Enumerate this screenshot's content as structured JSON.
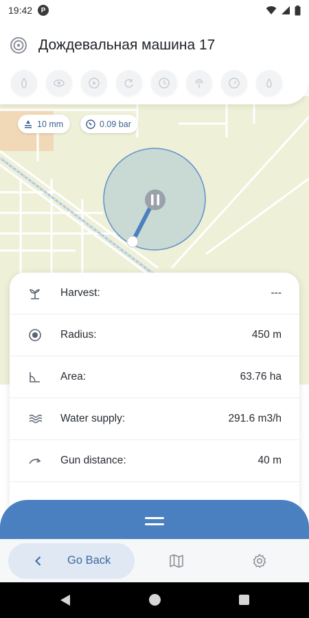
{
  "status_bar": {
    "time": "19:42",
    "icons": [
      "app-notification-icon",
      "wifi-icon",
      "signal-icon",
      "battery-icon"
    ]
  },
  "header": {
    "title": "Дождевальная машина 17",
    "title_icon": "irrigation-icon",
    "toolbar_icons": [
      "drop-icon",
      "eye-icon",
      "play-icon",
      "refresh-icon",
      "clock-icon",
      "antenna-icon",
      "gauge-icon",
      "water-drop-icon"
    ]
  },
  "chips": [
    {
      "icon": "rainfall-icon",
      "text": "10 mm"
    },
    {
      "icon": "pressure-gauge-icon",
      "text": "0.09 bar"
    }
  ],
  "map": {
    "state_icon": "pause-icon"
  },
  "details": [
    {
      "icon": "sprout-icon",
      "label": "Harvest:",
      "value": "---"
    },
    {
      "icon": "radius-icon",
      "label": "Radius:",
      "value": "450 m"
    },
    {
      "icon": "area-icon",
      "label": "Area:",
      "value": "63.76 ha"
    },
    {
      "icon": "waves-icon",
      "label": "Water supply:",
      "value": "291.6 m3/h"
    },
    {
      "icon": "arc-arrow-icon",
      "label": "Gun distance:",
      "value": "40 m"
    }
  ],
  "bottom_nav": {
    "back_label": "Go Back",
    "icons": [
      "chevron-left-icon",
      "map-icon",
      "gear-icon"
    ]
  },
  "colors": {
    "accent": "#4a80bf",
    "map_background": "#eef0d8",
    "circle_fill": "#c9d9d3",
    "circle_stroke": "#5e8fcb"
  }
}
